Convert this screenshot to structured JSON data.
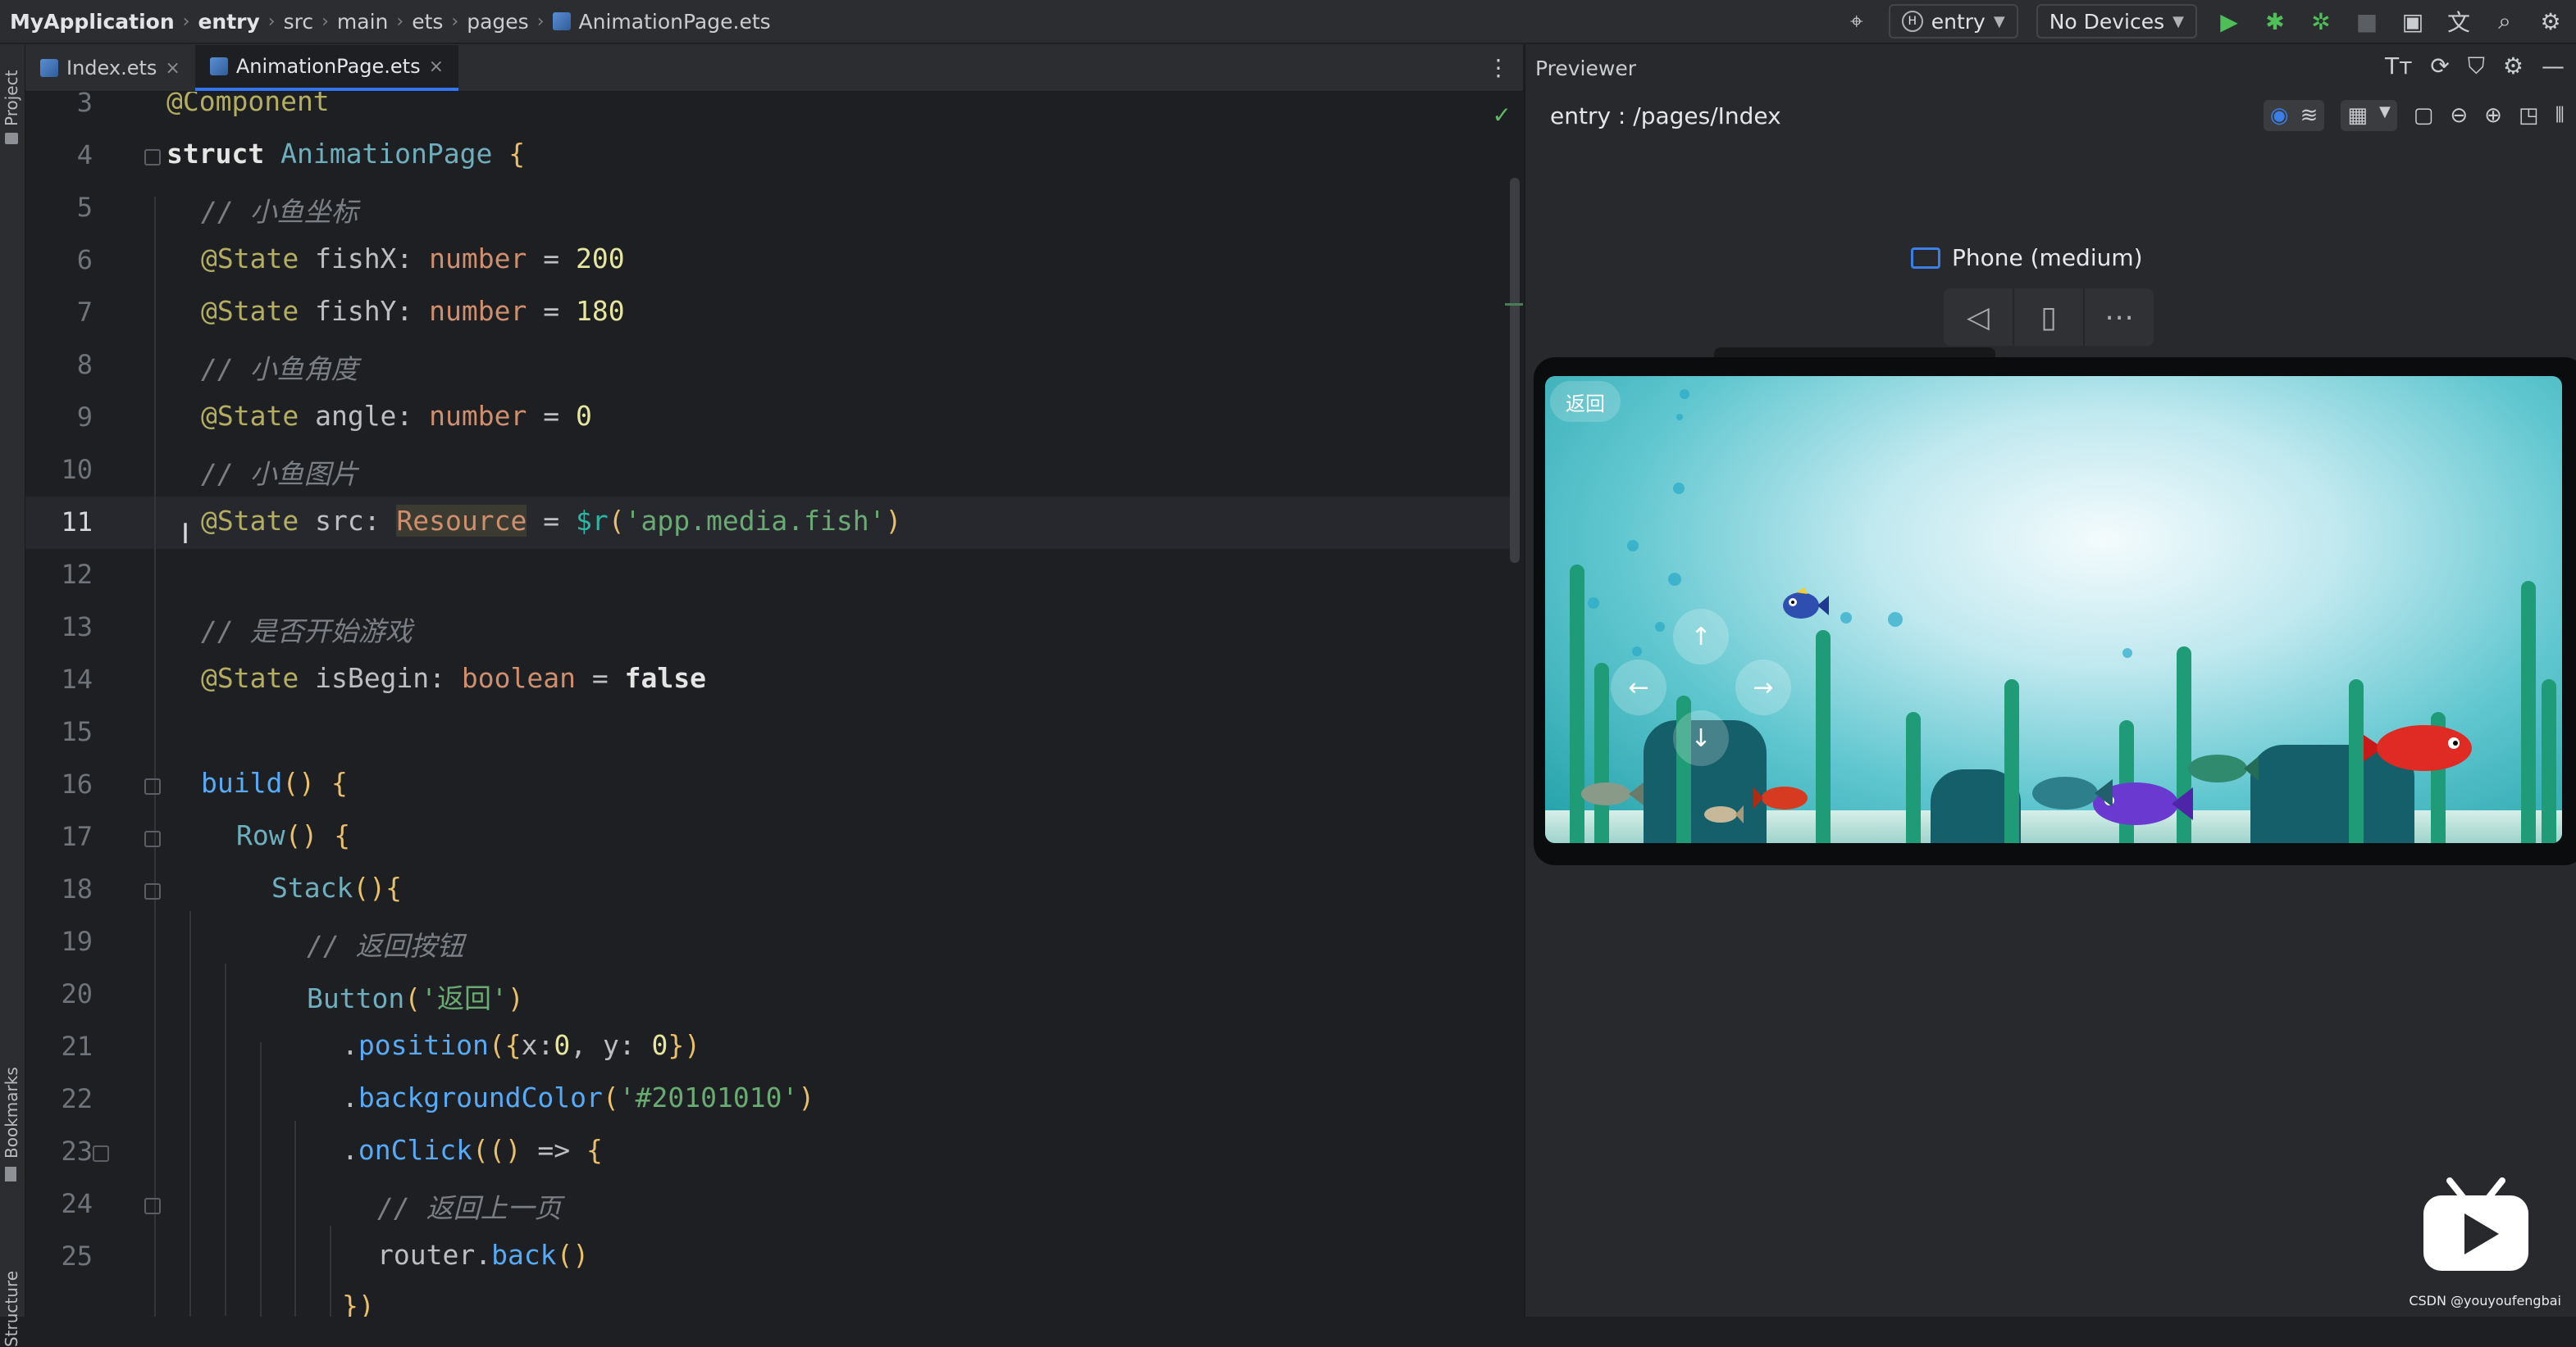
{
  "breadcrumb": {
    "items": [
      "MyApplication",
      "entry",
      "src",
      "main",
      "ets",
      "pages",
      "AnimationPage.ets"
    ]
  },
  "toolbar": {
    "module_select": "entry",
    "device_select": "No Devices",
    "icons": [
      "target-icon",
      "run-icon",
      "debug-icon",
      "attach-debugger-icon",
      "stop-icon",
      "device-manager-icon",
      "translate-icon",
      "search-icon",
      "settings-icon"
    ]
  },
  "sidebar": {
    "top_label": "Project",
    "bookmarks_label": "Bookmarks",
    "structure_label": "Structure"
  },
  "tabs": [
    {
      "label": "Index.ets",
      "active": false
    },
    {
      "label": "AnimationPage.ets",
      "active": true
    }
  ],
  "editor": {
    "current_line": 11,
    "line_numbers": [
      "3",
      "4",
      "5",
      "6",
      "7",
      "8",
      "9",
      "10",
      "11",
      "12",
      "13",
      "14",
      "15",
      "16",
      "17",
      "18",
      "19",
      "20",
      "21",
      "22",
      "23",
      "24",
      "25"
    ]
  },
  "preview": {
    "title": "Previewer",
    "route": "entry : /pages/Index",
    "device_name": "Phone (medium)",
    "app": {
      "back_label": "返回",
      "arrows": {
        "up": "↑",
        "left": "←",
        "right": "→",
        "down": "↓"
      }
    }
  },
  "watermark": "CSDN @youyoufengbai"
}
